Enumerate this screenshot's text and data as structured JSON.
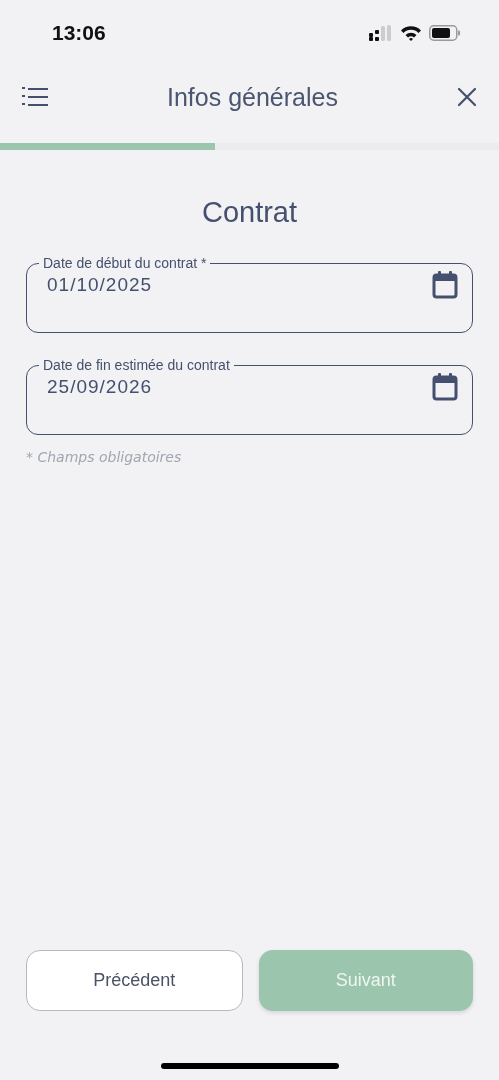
{
  "status_bar": {
    "time": "13:06"
  },
  "header": {
    "title": "Infos générales"
  },
  "progress": {
    "level": 0.43
  },
  "section": {
    "title": "Contrat"
  },
  "fields": [
    {
      "label": "Date de début du contrat *",
      "value": "01/10/2025"
    },
    {
      "label": "Date de fin estimée du contrat",
      "value": "25/09/2026"
    }
  ],
  "note": "* Champs obligatoires",
  "buttons": [
    {
      "label": "Précédent",
      "kind": "secondary"
    },
    {
      "label": "Suivant",
      "kind": "primary"
    }
  ]
}
